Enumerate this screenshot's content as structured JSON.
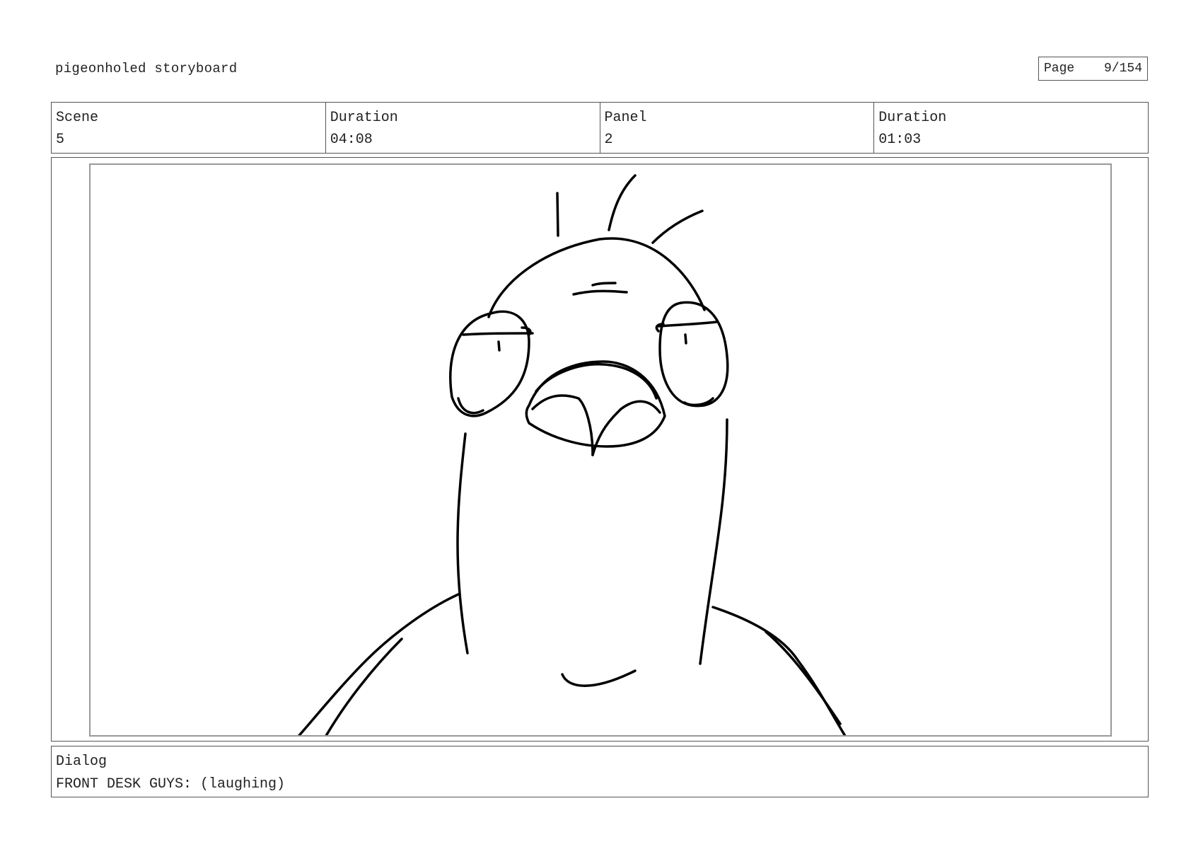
{
  "header": {
    "title": "pigeonholed storyboard",
    "page_label": "Page",
    "page_value": "9/154"
  },
  "info": {
    "scene_label": "Scene",
    "scene_value": "5",
    "scene_duration_label": "Duration",
    "scene_duration_value": "04:08",
    "panel_label": "Panel",
    "panel_value": "2",
    "panel_duration_label": "Duration",
    "panel_duration_value": "01:03"
  },
  "panel_image": {
    "icon": "pigeon-sketch"
  },
  "dialog": {
    "label": "Dialog",
    "text": "FRONT DESK GUYS: (laughing)"
  }
}
